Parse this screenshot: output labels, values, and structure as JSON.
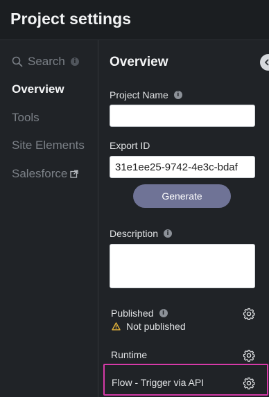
{
  "header": {
    "title": "Project settings"
  },
  "sidebar": {
    "search_label": "Search",
    "items": [
      {
        "label": "Overview",
        "active": true
      },
      {
        "label": "Tools"
      },
      {
        "label": "Site Elements"
      },
      {
        "label": "Salesforce"
      }
    ]
  },
  "main": {
    "title": "Overview",
    "project_name": {
      "label": "Project Name",
      "value": ""
    },
    "export_id": {
      "label": "Export ID",
      "value": "31e1ee25-9742-4e3c-bdaf"
    },
    "generate_label": "Generate",
    "description": {
      "label": "Description",
      "value": ""
    },
    "published": {
      "label": "Published",
      "status": "Not published"
    },
    "runtime": {
      "label": "Runtime"
    },
    "flow": {
      "label": "Flow - Trigger via API"
    }
  },
  "colors": {
    "background": "#202327",
    "header": "#1b1e21",
    "accent_button": "#6f7396",
    "highlight": "#d63aa8",
    "warning": "#e2b23a"
  }
}
